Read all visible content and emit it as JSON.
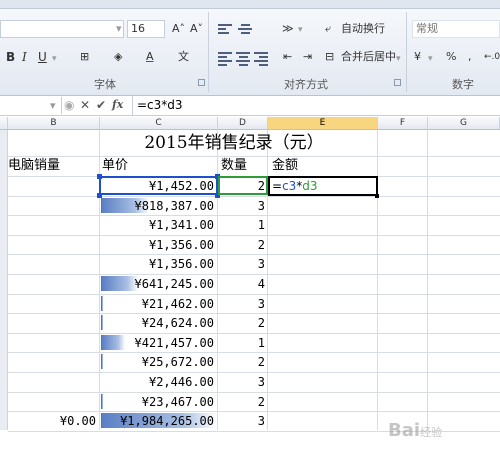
{
  "ribbon": {
    "font_size": "16",
    "grow_font": "A˄",
    "shrink_font": "A˅",
    "bold": "B",
    "italic": "I",
    "underline": "U",
    "wrap_text": "自动换行",
    "merge_center": "合并后居中",
    "number_format": "常规",
    "percent": "%",
    "comma": ",",
    "wen": "文",
    "group_font": "字体",
    "group_alignment": "对齐方式",
    "group_number": "数字"
  },
  "formula_bar": {
    "cancel": "✕",
    "confirm": "✔",
    "fx": "fx",
    "content": "=c3*d3"
  },
  "columns": [
    "B",
    "C",
    "D",
    "E",
    "F",
    "G"
  ],
  "active_column": "E",
  "sheet": {
    "title": "2015年销售纪录（元）",
    "headers": {
      "b": "电脑销量",
      "c": "单价",
      "d": "数量",
      "e": "金额"
    },
    "rows": [
      {
        "price": "¥1,452.00",
        "qty": "2",
        "bar": 0.0
      },
      {
        "price": "¥818,387.00",
        "qty": "3",
        "bar": 0.41
      },
      {
        "price": "¥1,341.00",
        "qty": "1",
        "bar": 0.0
      },
      {
        "price": "¥1,356.00",
        "qty": "2",
        "bar": 0.0
      },
      {
        "price": "¥1,356.00",
        "qty": "3",
        "bar": 0.0
      },
      {
        "price": "¥641,245.00",
        "qty": "4",
        "bar": 0.32
      },
      {
        "price": "¥21,462.00",
        "qty": "3",
        "bar": 0.01
      },
      {
        "price": "¥24,624.00",
        "qty": "2",
        "bar": 0.01
      },
      {
        "price": "¥421,457.00",
        "qty": "1",
        "bar": 0.21
      },
      {
        "price": "¥25,672.00",
        "qty": "2",
        "bar": 0.01
      },
      {
        "price": "¥2,446.00",
        "qty": "3",
        "bar": 0.0
      },
      {
        "price": "¥23,467.00",
        "qty": "2",
        "bar": 0.01
      }
    ],
    "total": {
      "b": "¥0.00",
      "price": "¥1,984,265.00",
      "qty": "3",
      "bar": 1.0
    },
    "active_cell_formula": {
      "eq": "=",
      "c": "c3",
      "op": "*",
      "d": "d3"
    }
  },
  "watermark": {
    "main": "Bai",
    "sub": "经验"
  },
  "colors": {
    "accent": "#1f4fd1",
    "ref_d": "#2f9a3a",
    "databar": "#5a7fc4",
    "active_header": "#f8d680"
  }
}
